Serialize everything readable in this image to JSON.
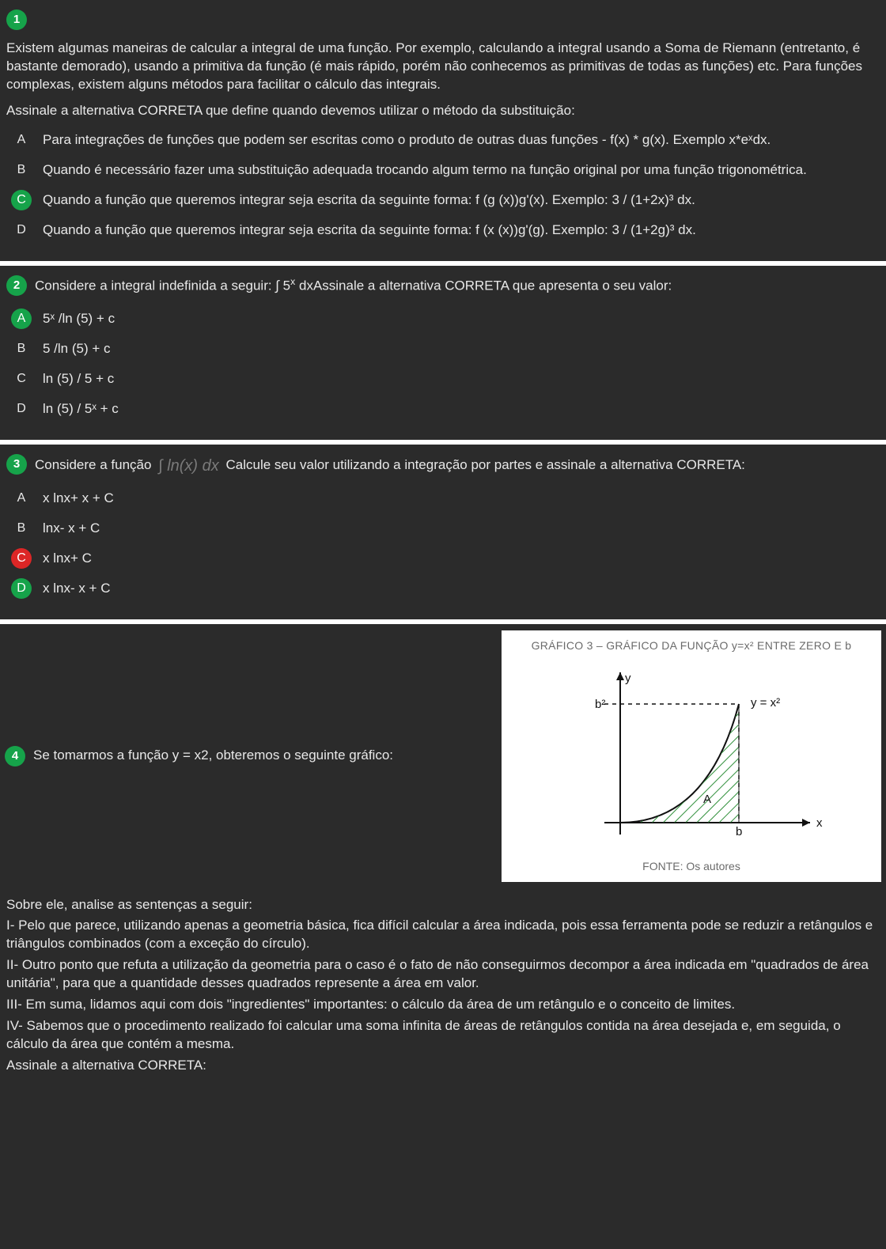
{
  "q1": {
    "number": "1",
    "stem_p1": "Existem algumas maneiras de calcular a integral de uma função. Por exemplo, calculando a integral usando a Soma de Riemann (entretanto, é bastante demorado), usando a primitiva da função (é mais rápido, porém não conhecemos as primitivas de todas as funções) etc. Para funções complexas, existem alguns métodos para facilitar o cálculo das integrais.",
    "stem_p2": "Assinale a alternativa CORRETA que define quando devemos utilizar o método da substituição:",
    "optA": {
      "letter": "A",
      "text": "Para integrações de funções que podem ser escritas como o produto de outras duas funções - f(x) * g(x). Exemplo x*eˣdx."
    },
    "optB": {
      "letter": "B",
      "text": "Quando é necessário fazer uma substituição adequada trocando algum termo na função original por uma função trigonométrica."
    },
    "optC": {
      "letter": "C",
      "text": "Quando a função que queremos integrar seja escrita da seguinte forma: f (g (x))g'(x). Exemplo: 3 / (1+2x)³ dx."
    },
    "optD": {
      "letter": "D",
      "text": "Quando a função que queremos integrar seja escrita da seguinte forma: f (x (x))g'(g). Exemplo: 3 / (1+2g)³ dx."
    }
  },
  "q2": {
    "number": "2",
    "stem_pre": "Considere a integral indefinida a seguir: ∫ 5",
    "stem_sup": "x",
    "stem_post": " dxAssinale a alternativa CORRETA que apresenta o seu valor:",
    "optA": {
      "letter": "A",
      "text": "5ˣ /ln (5) + c"
    },
    "optB": {
      "letter": "B",
      "text": "5 /ln (5) + c"
    },
    "optC": {
      "letter": "C",
      "text": "ln (5) / 5 + c"
    },
    "optD": {
      "letter": "D",
      "text": "ln (5) / 5ˣ + c"
    }
  },
  "q3": {
    "number": "3",
    "stem_pre": "Considere a função ",
    "integral_expr": "∫ ln(x) dx",
    "stem_post": " Calcule seu valor utilizando a integração por partes e assinale a alternativa CORRETA:",
    "optA": {
      "letter": "A",
      "text": "x lnx+ x + C"
    },
    "optB": {
      "letter": "B",
      "text": "lnx- x + C"
    },
    "optC": {
      "letter": "C",
      "text": "x lnx+ C"
    },
    "optD": {
      "letter": "D",
      "text": "x lnx- x + C"
    }
  },
  "q4": {
    "number": "4",
    "stem_left": "Se tomarmos a função y = x2, obteremos o seguinte gráfico:",
    "graph_title": "GRÁFICO 3 – GRÁFICO DA FUNÇÃO y=x² ENTRE ZERO E b",
    "graph_caption": "FONTE: Os autores",
    "axis_y": "y",
    "axis_x": "x",
    "label_b2": "b²",
    "label_b": "b",
    "label_curve": "y = x²",
    "label_A": "A",
    "analysis_intro": "Sobre ele, analise as sentenças a seguir:",
    "stmt1": "I- Pelo que parece, utilizando apenas a geometria básica, fica difícil calcular a área indicada, pois essa ferramenta pode se reduzir a retângulos e triângulos combinados (com a exceção do círculo).",
    "stmt2": "II- Outro ponto que refuta a utilização da geometria para o caso é o fato de não conseguirmos decompor a área indicada em \"quadrados de área unitária\", para que a quantidade desses quadrados represente a área em valor.",
    "stmt3": "III- Em suma, lidamos aqui com dois \"ingredientes\" importantes: o cálculo da área de um retângulo e o conceito de limites.",
    "stmt4": "IV- Sabemos que o procedimento realizado foi calcular uma soma infinita de áreas de retângulos contida na área desejada e, em seguida, o cálculo da área que contém a mesma.",
    "closing": "Assinale a alternativa CORRETA:"
  }
}
